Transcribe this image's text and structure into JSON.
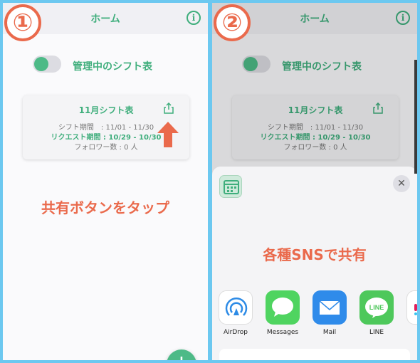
{
  "steps": [
    {
      "badge": "①",
      "header_title": "ホーム",
      "toggle_label": "管理中のシフト表",
      "card": {
        "title": "11月シフト表",
        "line1": "シフト期間　: 11/01 - 11/30",
        "line2": "リクエスト期間 : 10/29 - 10/30",
        "line3": "フォロワー数 : 0 人"
      },
      "caption": "共有ボタンをタップ",
      "fab_label": "+"
    },
    {
      "badge": "②",
      "header_title": "ホーム",
      "toggle_label": "管理中のシフト表",
      "card": {
        "title": "11月シフト表",
        "line1": "シフト期間　: 11/01 - 11/30",
        "line2": "リクエスト期間 : 10/29 - 10/30",
        "line3": "フォロワー数 : 0 人"
      },
      "sheet": {
        "close_label": "✕",
        "caption": "各種SNSで共有",
        "share_targets": [
          {
            "label": "AirDrop",
            "icon": "airdrop-icon"
          },
          {
            "label": "Messages",
            "icon": "messages-icon"
          },
          {
            "label": "Mail",
            "icon": "mail-icon"
          },
          {
            "label": "LINE",
            "icon": "line-icon"
          }
        ],
        "line_icon_text": "LINE"
      }
    }
  ],
  "colors": {
    "accent_green": "#3fae7c",
    "annotation_red": "#ea6a4c",
    "border_blue": "#6cc8f0"
  }
}
